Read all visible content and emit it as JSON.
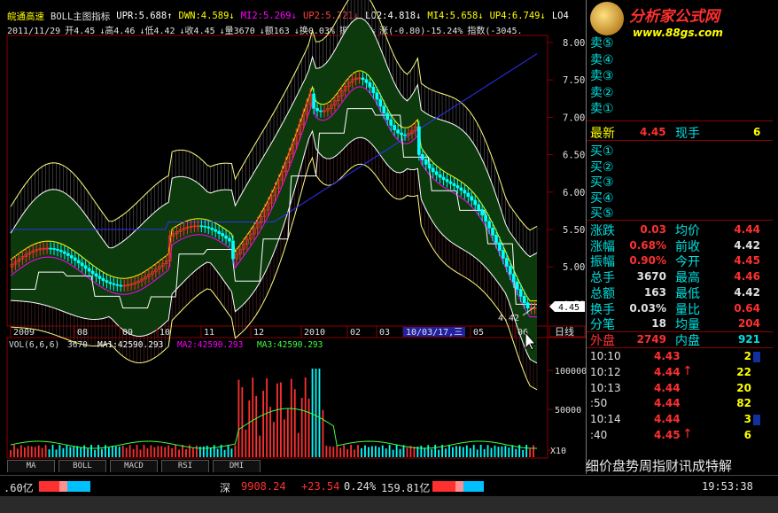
{
  "header": {
    "stock_name": "皖通高速",
    "indicator": "BOLL主图指标",
    "items": [
      {
        "label": "UPR:5.688",
        "arrow": "↑",
        "color": "#ffffff"
      },
      {
        "label": "DWN:4.589",
        "arrow": "↓",
        "color": "#ffff00"
      },
      {
        "label": "MI2:5.269",
        "arrow": "↓",
        "color": "#ff00ff"
      },
      {
        "label": "UP2:5.721",
        "arrow": "↓",
        "color": "#ff4040"
      },
      {
        "label": "LO2:4.818",
        "arrow": "↓",
        "color": "#ffffff"
      },
      {
        "label": "MI4:5.658",
        "arrow": "↓",
        "color": "#ffff00"
      },
      {
        "label": "UP4:6.749",
        "arrow": "↓",
        "color": "#ffff00"
      },
      {
        "label": "LO4",
        "arrow": "",
        "color": "#ffffff"
      }
    ]
  },
  "info_line": [
    "2011/11/29",
    "开4.45",
    "↓高4.46",
    "↓低4.42",
    "↓收4.45",
    "↓量3670",
    "↓额163",
    "↓换0.03%",
    "振0.76%",
    "涨(-0.80)-15.24%",
    "指数(-3045."
  ],
  "price_axis": [
    "8.00",
    "7.50",
    "7.00",
    "6.50",
    "6.00",
    "5.50",
    "5.00",
    "4.50"
  ],
  "current_price_tag": "4.45",
  "low_label": "4.42",
  "date_axis": [
    "2009",
    "08",
    "09",
    "10",
    "11",
    "12",
    "2010",
    "02",
    "03",
    "10/03/17,三",
    "05",
    "06"
  ],
  "period": "日线",
  "volume_header": {
    "label": "VOL(6,6,6)",
    "val": "3670",
    "ma1": "MA1:42590.293",
    "ma2": "MA2:42590.293",
    "ma3": "MA3:42590.293"
  },
  "volume_axis": [
    "100000",
    "50000",
    "X10"
  ],
  "bottom_tabs": [
    "MA",
    "BOLL",
    "MACD",
    "RSI",
    "DMI"
  ],
  "status": {
    "left": ".60亿",
    "shen": "深",
    "index": "9908.24",
    "change": "+23.54",
    "pct": "0.24%",
    "amount": "159.81亿",
    "time": "19:53:38"
  },
  "logo": {
    "title": "分析家公式网",
    "url": "www.88gs.com"
  },
  "orderbook": {
    "sell": [
      "卖⑤",
      "卖④",
      "卖③",
      "卖②",
      "卖①"
    ],
    "latest_label": "最新",
    "latest": "4.45",
    "now_label": "现手",
    "now": "6",
    "buy": [
      "买①",
      "买②",
      "买③",
      "买④",
      "买⑤"
    ]
  },
  "stats": [
    {
      "l1": "涨跌",
      "v1": "0.03",
      "l2": "均价",
      "v2": "4.44"
    },
    {
      "l1": "涨幅",
      "v1": "0.68%",
      "l2": "前收",
      "v2": "4.42"
    },
    {
      "l1": "振幅",
      "v1": "0.90%",
      "l2": "今开",
      "v2": "4.45"
    },
    {
      "l1": "总手",
      "v1": "3670",
      "l2": "最高",
      "v2": "4.46"
    },
    {
      "l1": "总额",
      "v1": "163",
      "l2": "最低",
      "v2": "4.42"
    },
    {
      "l1": "换手",
      "v1": "0.03%",
      "l2": "量比",
      "v2": "0.64"
    },
    {
      "l1": "分笔",
      "v1": "18",
      "l2": "均量",
      "v2": "204"
    }
  ],
  "outer": {
    "l1": "外盘",
    "v1": "2749",
    "l2": "内盘",
    "v2": "921"
  },
  "ticks": [
    {
      "t": "10:10",
      "p": "4.43",
      "d": "",
      "v": "2"
    },
    {
      "t": "10:12",
      "p": "4.44",
      "d": "↑",
      "v": "22"
    },
    {
      "t": "10:13",
      "p": "4.44",
      "d": "",
      "v": "20"
    },
    {
      "t": ":50",
      "p": "4.44",
      "d": "",
      "v": "82"
    },
    {
      "t": "10:14",
      "p": "4.44",
      "d": "",
      "v": "3"
    },
    {
      "t": ":40",
      "p": "4.45",
      "d": "↑",
      "v": "6"
    }
  ],
  "detail_tabs": "细价盘势周指财讯成特解",
  "colors": {
    "up": "#ff3030",
    "down": "#00ffff",
    "green_fill": "#0c3a0c",
    "yellow": "#ffff00",
    "magenta": "#ff00ff",
    "blue": "#2020ff"
  }
}
